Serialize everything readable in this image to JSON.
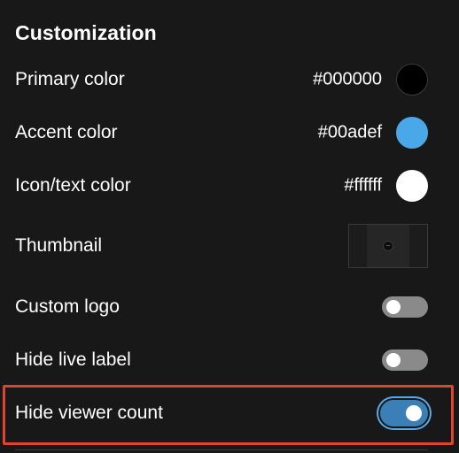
{
  "section": {
    "title": "Customization"
  },
  "colors": {
    "primary": {
      "label": "Primary color",
      "value": "#000000"
    },
    "accent": {
      "label": "Accent color",
      "value": "#00adef"
    },
    "icon_text": {
      "label": "Icon/text color",
      "value": "#ffffff"
    }
  },
  "swatch_colors": {
    "primary": "#000000",
    "accent": "#4aa8e8",
    "icon_text": "#ffffff"
  },
  "thumbnail": {
    "label": "Thumbnail"
  },
  "toggles": {
    "custom_logo": {
      "label": "Custom logo",
      "checked": false
    },
    "hide_live_label": {
      "label": "Hide live label",
      "checked": false
    },
    "hide_viewer_count": {
      "label": "Hide viewer count",
      "checked": true
    }
  },
  "highlight_color": "#e0432e"
}
